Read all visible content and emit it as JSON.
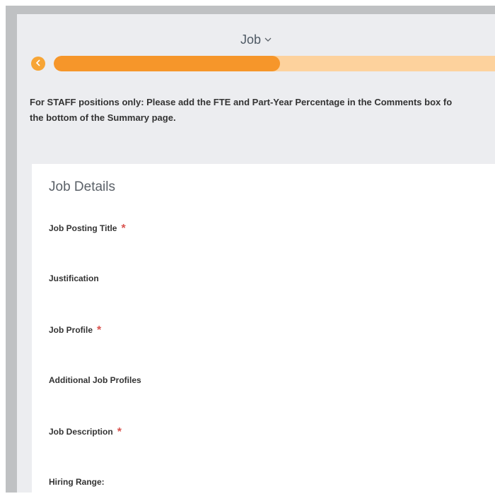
{
  "header": {
    "title": "Job",
    "chevron": "chevron-down-icon"
  },
  "progress": {
    "back_icon": "chevron-left-icon",
    "percent": 50,
    "fill_color": "#f6962a",
    "track_color": "#fdd29d"
  },
  "instruction": {
    "line1": "For STAFF positions only: Please add the FTE and Part-Year Percentage in the Comments box fo",
    "line2": "the bottom of the Summary page."
  },
  "card": {
    "title": "Job Details",
    "required_marker": "*",
    "fields": [
      {
        "label": "Job Posting Title",
        "required": true
      },
      {
        "label": "Justification",
        "required": false
      },
      {
        "label": "Job Profile",
        "required": true
      },
      {
        "label": "Additional Job Profiles",
        "required": false
      },
      {
        "label": "Job Description",
        "required": true
      },
      {
        "label": "Hiring Range:",
        "required": false
      }
    ]
  },
  "colors": {
    "accent": "#f7a535",
    "required": "#d9534f"
  }
}
